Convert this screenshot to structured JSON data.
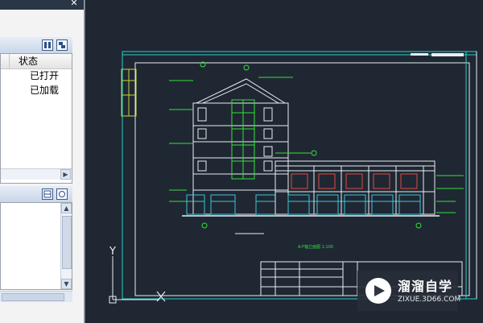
{
  "layer_panel": {
    "column_status": "状态",
    "rows": [
      {
        "status": "已打开"
      },
      {
        "status": "已加载"
      }
    ]
  },
  "drawing": {
    "caption": "A-F轴立面图 1:100"
  },
  "axes": {
    "y_label": "Y"
  },
  "watermark": {
    "brand": "溜溜自学",
    "url": "ZIXUE.3D66.COM"
  },
  "colors": {
    "canvas_bg": "#1f2733",
    "frame": "#2ad0c8",
    "line_white": "#e8eef2",
    "line_green": "#35e03a",
    "line_cyan": "#39c6d8",
    "line_red": "#e24b3c"
  }
}
